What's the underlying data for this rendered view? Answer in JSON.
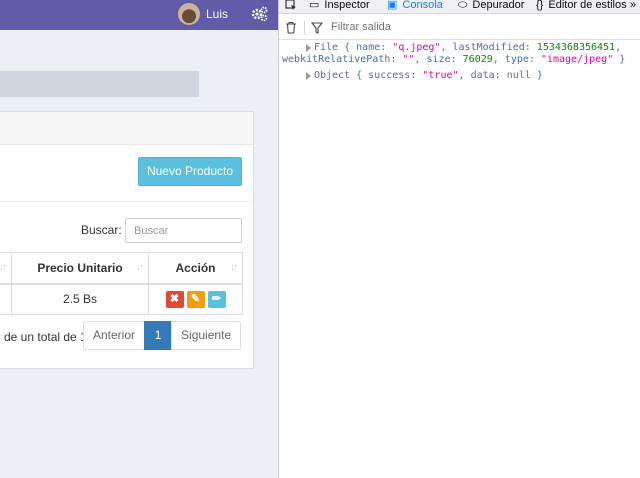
{
  "app": {
    "user": {
      "name": "Luis"
    },
    "products": {
      "new_button": "Nuevo Producto",
      "search": {
        "label": "Buscar:",
        "placeholder": "Buscar"
      },
      "columns": [
        "Precio Unitario",
        "Acción"
      ],
      "rows": [
        {
          "unit_price": "2.5 Bs"
        }
      ],
      "pagination": {
        "info_text": "de un total de 1",
        "prev": "Anterior",
        "current": "1",
        "next": "Siguiente"
      }
    }
  },
  "devtools": {
    "tabs": [
      {
        "label": "Inspector",
        "active": false
      },
      {
        "label": "Consola",
        "active": true
      },
      {
        "label": "Depurador",
        "active": false
      },
      {
        "label": "Editor de estilos",
        "active": false
      }
    ],
    "more": "»",
    "filter_placeholder": "Filtrar salida",
    "console": [
      {
        "type": "File",
        "name": "q.jpeg",
        "lastModified": "1534368356451",
        "webkitRelativePath": "",
        "size": "76029",
        "mime": "image/jpeg"
      },
      {
        "type": "Object",
        "success": "true",
        "data": "null"
      }
    ]
  }
}
